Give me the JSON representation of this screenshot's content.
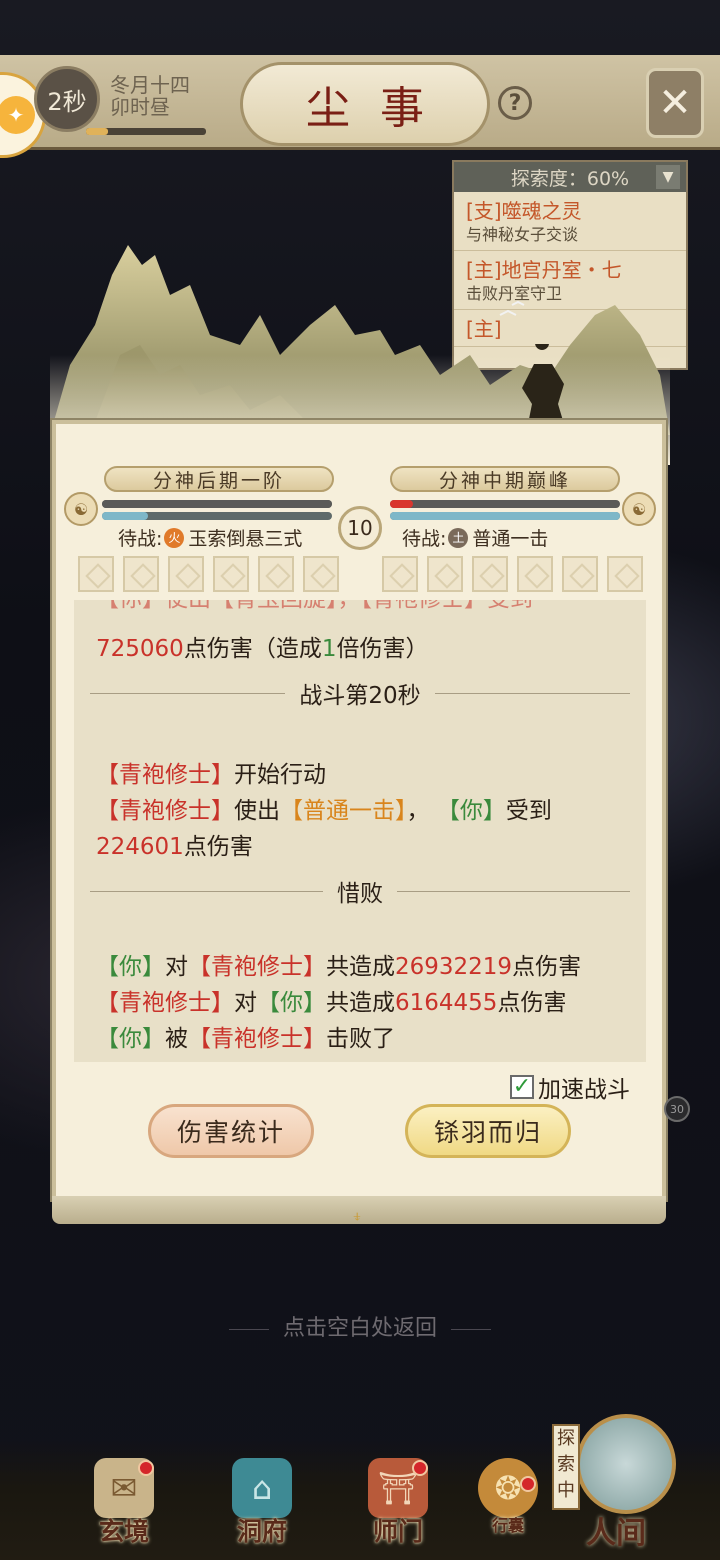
{
  "header": {
    "timer": "2秒",
    "date_line1": "冬月十四",
    "date_line2": "卯时昼",
    "title": "尘事",
    "help_icon": "help-icon",
    "close_icon": "close-icon"
  },
  "quests": {
    "explore_label": "探索度：60%",
    "items": [
      {
        "title": "[支]噬魂之灵",
        "desc": "与神秘女子交谈"
      },
      {
        "title": "[主]地宫丹室・七",
        "desc": "击败丹室守卫"
      },
      {
        "title": "[主]",
        "desc": ""
      }
    ]
  },
  "battle": {
    "player_realm": "分神后期一阶",
    "enemy_realm": "分神中期巅峰",
    "round": "10",
    "player_hp": 1.0,
    "player_mp": 0.2,
    "enemy_hp": 0.1,
    "enemy_mp": 1.0,
    "player_wait_label": "待战:",
    "player_elem": "火",
    "player_skill": "玉索倒悬三式",
    "enemy_wait_label": "待战:",
    "enemy_elem": "土",
    "enemy_skill": "普通一击",
    "slot_count": 6
  },
  "log": {
    "partial_top": "【你】使出【青玉回旋】，【青袍修士】受到",
    "l1_num": "725060",
    "l1_a": "点伤害（造成",
    "l1_mult": "1",
    "l1_b": "倍伤害）",
    "sep1": "战斗第20秒",
    "enemy_name": "【青袍修士】",
    "you": "【你】",
    "start_action": "开始行动",
    "use": "使出",
    "skill": "【普通一击】",
    "comma": "，",
    "received": "受到",
    "l4_num": "224601",
    "dmg": "点伤害",
    "sep2": "惜败",
    "to": "对",
    "total": "共造成",
    "total_you": "26932219",
    "total_enemy": "6164455",
    "defeated_by": "被",
    "defeated": "击败了"
  },
  "controls": {
    "speed_label": "加速战斗",
    "speed_checked": true,
    "stats_button": "伤害统计",
    "leave_button": "铩羽而归",
    "side_count": "30"
  },
  "back_tip": "点击空白处返回",
  "nav": {
    "items": [
      {
        "label": "玄境",
        "icon": "scroll-icon"
      },
      {
        "label": "洞府",
        "icon": "pavilion-icon"
      },
      {
        "label": "师门",
        "icon": "gate-icon"
      },
      {
        "label": "行囊",
        "icon": "bag-icon"
      }
    ],
    "world_label": "人间",
    "explore_tag": "探索中"
  },
  "colors": {
    "red_text": "#c9322a",
    "green_text": "#3a8a3c",
    "orange_text": "#d9851c",
    "hp_red": "#d9362e",
    "mp_blue": "#7eb7c8"
  }
}
